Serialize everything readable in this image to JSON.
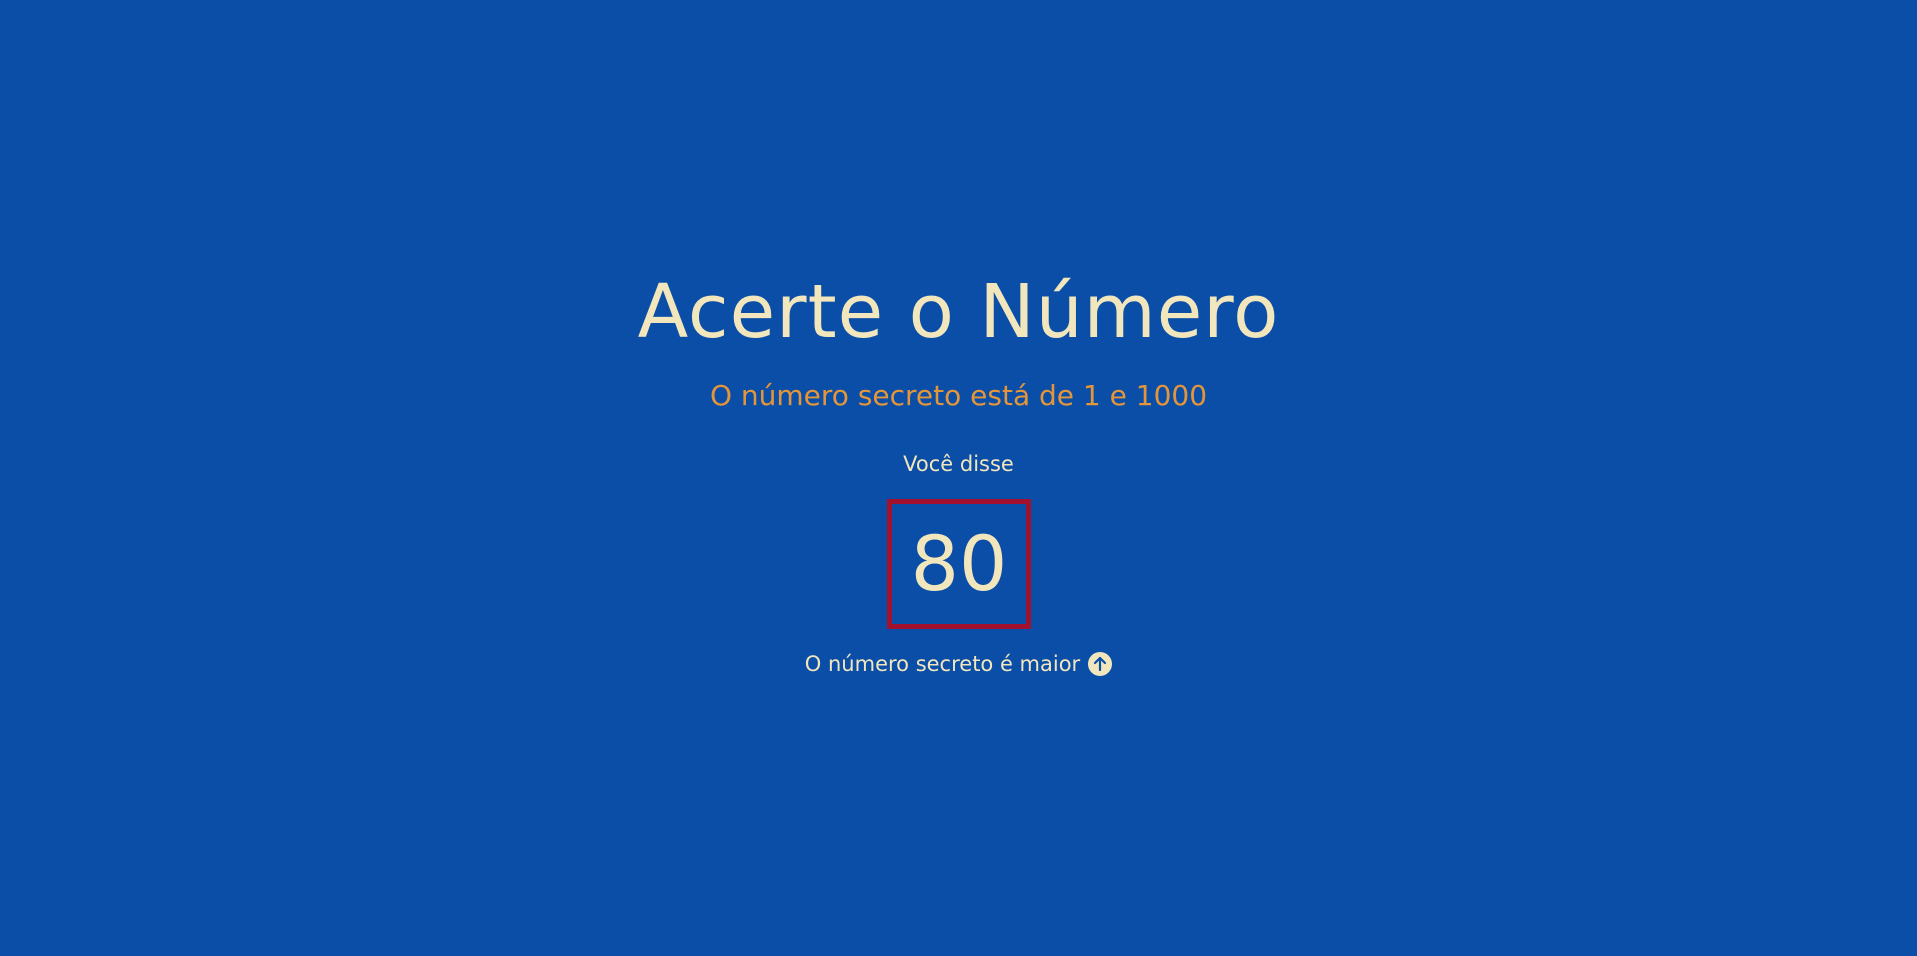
{
  "game": {
    "title": "Acerte o Número",
    "subtitle": "O número secreto está de 1 e 1000",
    "said_label": "Você disse",
    "guess": "80",
    "hint": "O número secreto é maior",
    "hint_icon": "arrow-up-circle-icon"
  },
  "colors": {
    "background": "#0b4ea8",
    "text": "#f2e6bd",
    "accent": "#e3953a",
    "box_border": "#a3112e"
  }
}
